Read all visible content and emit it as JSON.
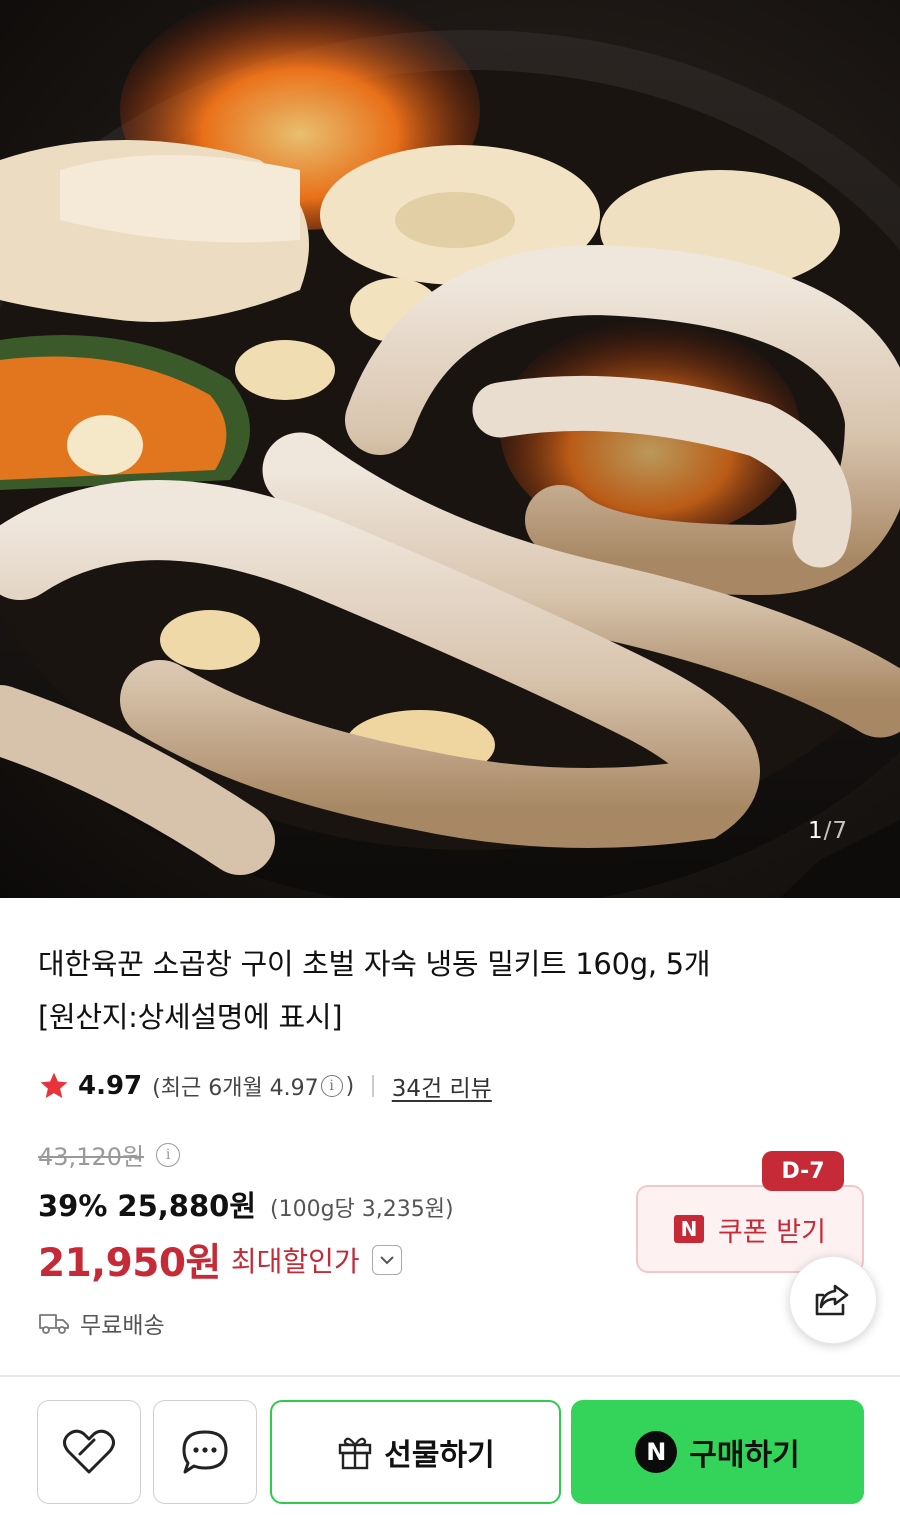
{
  "product": {
    "image_counter": {
      "current": "1",
      "separator": "/",
      "total": "7"
    },
    "title_line1": "대한육꾼 소곱창 구이 초벌 자숙 냉동 밀키트 160g, 5개",
    "title_line2": "[원산지:상세설명에 표시]"
  },
  "rating": {
    "score": "4.97",
    "recent_open": "(최근 6개월 4.97",
    "info_glyph": "i",
    "recent_close": ")",
    "review_link": "34건 리뷰"
  },
  "price": {
    "original": "43,120원",
    "info_glyph": "i",
    "discount_pct": "39%",
    "sale": "25,880원",
    "unit": "(100g당 3,235원)",
    "max_discount": "21,950원",
    "max_discount_label": "최대할인가"
  },
  "coupon": {
    "dday": "D-7",
    "badge": "N",
    "label": "쿠폰 받기"
  },
  "shipping": {
    "label": "무료배송"
  },
  "bottom_bar": {
    "gift_label": "선물하기",
    "buy_badge": "N",
    "buy_label": "구매하기"
  },
  "colors": {
    "accent_red": "#c62a36",
    "naver_green": "#34d45a",
    "star": "#e8323c"
  },
  "icons": [
    "star-icon",
    "info-icon",
    "chevron-down-icon",
    "share-icon",
    "truck-icon",
    "heart-icon",
    "chat-icon",
    "gift-icon"
  ]
}
